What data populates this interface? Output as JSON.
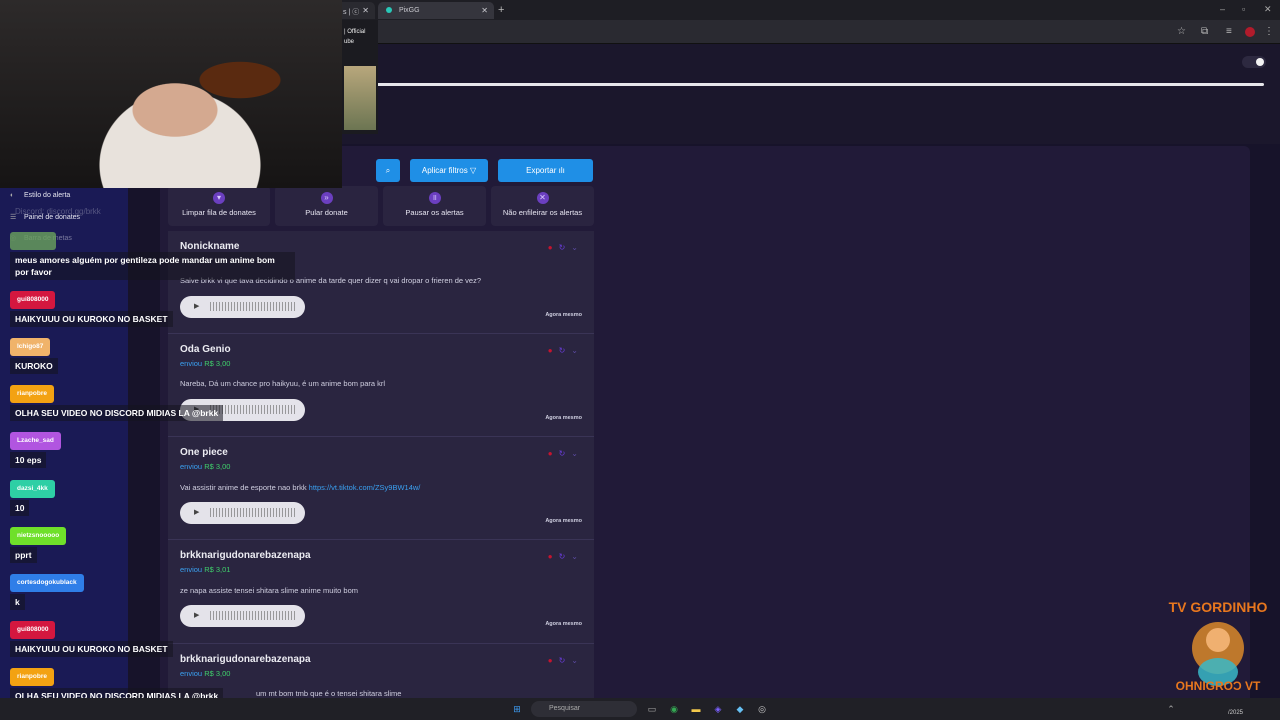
{
  "browser": {
    "tabs": [
      {
        "label": "s | ⓒ"
      },
      {
        "label": "PixGG"
      }
    ],
    "new_tab": "+",
    "window_controls": [
      "–",
      "▫",
      "✕"
    ]
  },
  "mini_video": {
    "caption_line1": "| Official",
    "caption_line2": "ube"
  },
  "overlay_nav": {
    "items": [
      {
        "label": "Estilo do alerta"
      },
      {
        "label": "Painel de donates"
      },
      {
        "label": "Barra de metas"
      }
    ],
    "ghost_text": "Discord: discord.gg/brkk"
  },
  "toolbar": {
    "search_icon": "search-icon",
    "filters_label": "Aplicar filtros",
    "export_label": "Exportar"
  },
  "actions": [
    {
      "label": "Limpar fila de donates",
      "icon": "trash-icon"
    },
    {
      "label": "Pular donate",
      "icon": "skip-icon"
    },
    {
      "label": "Pausar os alertas",
      "icon": "pause-icon"
    },
    {
      "label": "Não enfileirar os alertas",
      "icon": "bell-off-icon"
    }
  ],
  "donations": [
    {
      "name": "Nonickname",
      "sent": "",
      "amount": "",
      "message": "Salve brkk vi que tava decidindo o anime da tarde quer dizer q vai dropar o frieren de vez?",
      "link": "",
      "time": "Agora mesmo"
    },
    {
      "name": "Oda Genio",
      "sent": "enviou",
      "amount": "R$ 3,00",
      "message": "Nareba, Dá um chance pro haikyuu, é um anime bom para krl",
      "link": "",
      "time": "Agora mesmo"
    },
    {
      "name": "One piece",
      "sent": "enviou",
      "amount": "R$ 3,00",
      "message": "Vai assistir anime de esporte nao brkk ",
      "link": "https://vt.tiktok.com/ZSy9BW14w/",
      "time": "Agora mesmo"
    },
    {
      "name": "brkknarigudonarebazenapa",
      "sent": "enviou",
      "amount": "R$ 3,01",
      "message": "ze napa assiste tensei shitara slime anime muito bom",
      "link": "",
      "time": "Agora mesmo"
    },
    {
      "name": "brkknarigudonarebazenapa",
      "sent": "enviou",
      "amount": "R$ 3,00",
      "message": "um mt bom tmb que é o tensei shitara slime",
      "link": "",
      "time": ""
    }
  ],
  "chat": [
    {
      "user": "",
      "color": "#6aa35c",
      "message": "meus amores alguém por gentileza pode mandar um anime bom por favor"
    },
    {
      "user": "gui808000",
      "color": "#d4173f",
      "message": "HAIKYUUU OU KUROKO NO BASKET"
    },
    {
      "user": "Ichigo87",
      "color": "#f0b36a",
      "message": "KUROKO"
    },
    {
      "user": "rianpobre",
      "color": "#f3a212",
      "message": "OLHA SEU VIDEO NO DISCORD MIDIAS LA @brkk"
    },
    {
      "user": "Lzache_sad",
      "color": "#b155e0",
      "message": "10 eps"
    },
    {
      "user": "dazsi_4kk",
      "color": "#2ecfa5",
      "message": "10"
    },
    {
      "user": "nietzsnooooo",
      "color": "#6fe02a",
      "message": "pprt"
    },
    {
      "user": "cortesdogokublack",
      "color": "#2f7ee8",
      "message": "k"
    },
    {
      "user": "gui808000",
      "color": "#d4173f",
      "message": "HAIKYUUU OU KUROKO NO BASKET"
    },
    {
      "user": "rianpobre",
      "color": "#f3a212",
      "message": "OLHA SEU VIDEO NO DISCORD MIDIAS LA @brkk"
    }
  ],
  "taskbar": {
    "search_placeholder": "Pesquisar",
    "time": "",
    "date": "/2025"
  },
  "watermark": {
    "text_top": "TV GORDINHO",
    "text_bottom": "OHNIGROƆ VT"
  }
}
